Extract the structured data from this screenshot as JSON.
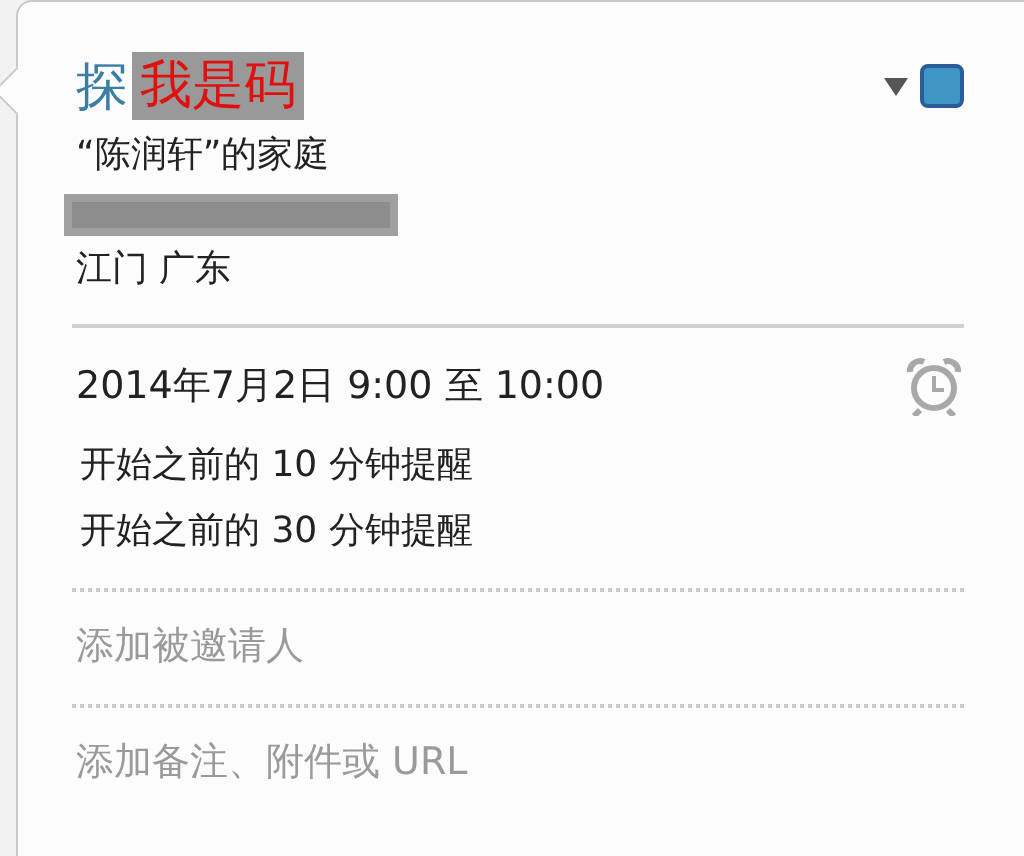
{
  "event": {
    "title": "探",
    "title_annotation": "我是码",
    "color": "#3f95c4",
    "calendar": "“陈润轩”的家庭",
    "redacted_line": true,
    "location": "江门 广东"
  },
  "time": {
    "text": "2014年7月2日 9:00 至 10:00",
    "alerts": [
      "开始之前的 10 分钟提醒",
      "开始之前的 30 分钟提醒"
    ]
  },
  "invitees": {
    "placeholder": "添加被邀请人"
  },
  "notes": {
    "placeholder": "添加备注、附件或 URL"
  }
}
